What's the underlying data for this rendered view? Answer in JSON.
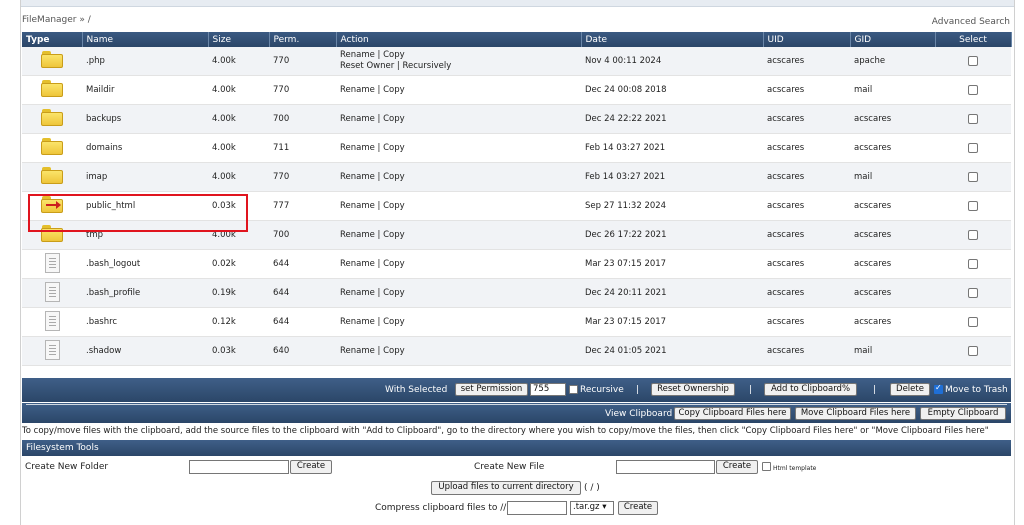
{
  "breadcrumb": "FileManager » /",
  "advanced_search": "Advanced Search",
  "columns": [
    "Type",
    "Name",
    "Size",
    "Perm.",
    "Action",
    "Date",
    "UID",
    "GID",
    "Select"
  ],
  "files": [
    {
      "type": "folder",
      "name": ".php",
      "size": "4.00k",
      "perm": "770",
      "action1": "Rename | Copy",
      "action2": "Reset Owner | Recursively",
      "date": "Nov 4 00:11 2024",
      "uid": "acscares",
      "gid": "apache"
    },
    {
      "type": "folder",
      "name": "Maildir",
      "size": "4.00k",
      "perm": "770",
      "action1": "Rename | Copy",
      "action2": "",
      "date": "Dec 24 00:08 2018",
      "uid": "acscares",
      "gid": "mail"
    },
    {
      "type": "folder",
      "name": "backups",
      "size": "4.00k",
      "perm": "700",
      "action1": "Rename | Copy",
      "action2": "",
      "date": "Dec 24 22:22 2021",
      "uid": "acscares",
      "gid": "acscares"
    },
    {
      "type": "folder",
      "name": "domains",
      "size": "4.00k",
      "perm": "711",
      "action1": "Rename | Copy",
      "action2": "",
      "date": "Feb 14 03:27 2021",
      "uid": "acscares",
      "gid": "acscares"
    },
    {
      "type": "folder",
      "name": "imap",
      "size": "4.00k",
      "perm": "770",
      "action1": "Rename | Copy",
      "action2": "",
      "date": "Feb 14 03:27 2021",
      "uid": "acscares",
      "gid": "mail"
    },
    {
      "type": "folder-link",
      "name": "public_html",
      "size": "0.03k",
      "perm": "777",
      "action1": "Rename | Copy",
      "action2": "",
      "date": "Sep 27 11:32 2024",
      "uid": "acscares",
      "gid": "acscares"
    },
    {
      "type": "folder",
      "name": "tmp",
      "size": "4.00k",
      "perm": "700",
      "action1": "Rename | Copy",
      "action2": "",
      "date": "Dec 26 17:22 2021",
      "uid": "acscares",
      "gid": "acscares"
    },
    {
      "type": "file",
      "name": ".bash_logout",
      "size": "0.02k",
      "perm": "644",
      "action1": "Rename | Copy",
      "action2": "",
      "date": "Mar 23 07:15 2017",
      "uid": "acscares",
      "gid": "acscares"
    },
    {
      "type": "file",
      "name": ".bash_profile",
      "size": "0.19k",
      "perm": "644",
      "action1": "Rename | Copy",
      "action2": "",
      "date": "Dec 24 20:11 2021",
      "uid": "acscares",
      "gid": "acscares"
    },
    {
      "type": "file",
      "name": ".bashrc",
      "size": "0.12k",
      "perm": "644",
      "action1": "Rename | Copy",
      "action2": "",
      "date": "Mar 23 07:15 2017",
      "uid": "acscares",
      "gid": "acscares"
    },
    {
      "type": "file",
      "name": ".shadow",
      "size": "0.03k",
      "perm": "640",
      "action1": "Rename | Copy",
      "action2": "",
      "date": "Dec 24 01:05 2021",
      "uid": "acscares",
      "gid": "mail"
    }
  ],
  "selected_bar": {
    "with_selected": "With Selected",
    "set_permission": "set Permission",
    "permission_value": "755",
    "recursive": "Recursive",
    "pipe": "|",
    "reset_ownership": "Reset Ownership",
    "add_to_clipboard": "Add to Clipboard%",
    "delete": "Delete",
    "move_to_trash": "Move to Trash"
  },
  "clipboard_bar": {
    "view_clipboard": "View Clipboard",
    "copy_here": "Copy Clipboard Files here",
    "move_here": "Move Clipboard Files here",
    "empty": "Empty Clipboard"
  },
  "note": "To copy/move files with the clipboard, add the source files to the clipboard with \"Add to Clipboard\", go to the directory where you wish to copy/move the files, then click \"Copy Clipboard Files here\" or \"Move Clipboard Files here\"",
  "tools": {
    "title": "Filesystem Tools",
    "new_folder_label": "Create New Folder",
    "new_file_label": "Create New File",
    "create": "Create",
    "html_template": "Html template",
    "upload": "Upload files to current directory",
    "upload_path": "( / )",
    "compress_label": "Compress clipboard files to //",
    "compress_ext": ".tar.gz"
  },
  "colors": {
    "header": "#2f4c72",
    "highlight": "#e0141e",
    "folder": "#f4d04a"
  }
}
